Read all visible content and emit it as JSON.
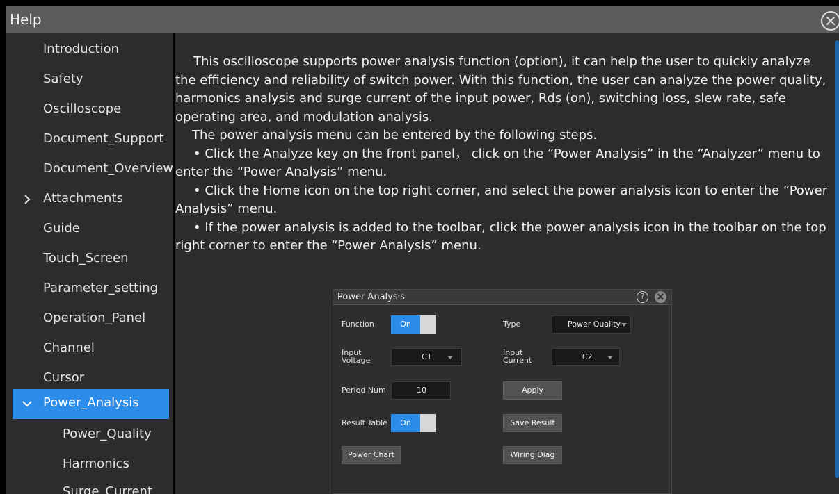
{
  "window": {
    "title": "Help"
  },
  "sidebar": {
    "items": [
      {
        "label": "Introduction"
      },
      {
        "label": "Safety"
      },
      {
        "label": "Oscilloscope"
      },
      {
        "label": "Document_Support"
      },
      {
        "label": "Document_Overview"
      },
      {
        "label": "Attachments",
        "expandable": true,
        "expanded": false
      },
      {
        "label": "Guide"
      },
      {
        "label": "Touch_Screen"
      },
      {
        "label": "Parameter_setting"
      },
      {
        "label": "Operation_Panel"
      },
      {
        "label": "Channel"
      },
      {
        "label": "Cursor"
      },
      {
        "label": "Power_Analysis",
        "expandable": true,
        "expanded": true,
        "selected": true
      },
      {
        "label": "Power_Quality",
        "child": true
      },
      {
        "label": "Harmonics",
        "child": true
      },
      {
        "label": "Surge_Current",
        "child": true
      }
    ]
  },
  "content": {
    "p1": "This oscilloscope supports power analysis function (option), it can help the user to quickly analyze the efficiency and reliability of switch power. With this function, the user can analyze the power quality, harmonics analysis and surge current of the input power, Rds (on), switching loss, slew rate, safe operating area, and modulation analysis.",
    "p2": "The power analysis menu can be entered by the following steps.",
    "p3": "• Click the Analyze key on the front panel， click on the “Power Analysis” in the “Analyzer” menu to enter the “Power Analysis” menu.",
    "p4": "• Click the Home icon on the top right corner, and select the power analysis icon to enter the “Power Analysis” menu.",
    "p5": "• If the power analysis is added to the toolbar, click the power analysis icon in the toolbar on the top right corner to enter the “Power Analysis” menu."
  },
  "dialog": {
    "title": "Power Analysis",
    "help_glyph": "?",
    "function": {
      "label": "Function",
      "state": "On"
    },
    "type": {
      "label": "Type",
      "value": "Power Quality"
    },
    "input_voltage": {
      "label_line1": "Input",
      "label_line2": "Voltage",
      "value": "C1"
    },
    "input_current": {
      "label_line1": "Input",
      "label_line2": "Current",
      "value": "C2"
    },
    "period_num": {
      "label": "Period Num",
      "value": "10"
    },
    "apply_label": "Apply",
    "result_table": {
      "label": "Result Table",
      "state": "On"
    },
    "save_result_label": "Save Result",
    "power_chart_label": "Power Chart",
    "wiring_diag_label": "Wiring Diag"
  },
  "colors": {
    "accent": "#2b8de9",
    "panel": "#2c2c2c",
    "titlebar": "#5c5c5c"
  }
}
